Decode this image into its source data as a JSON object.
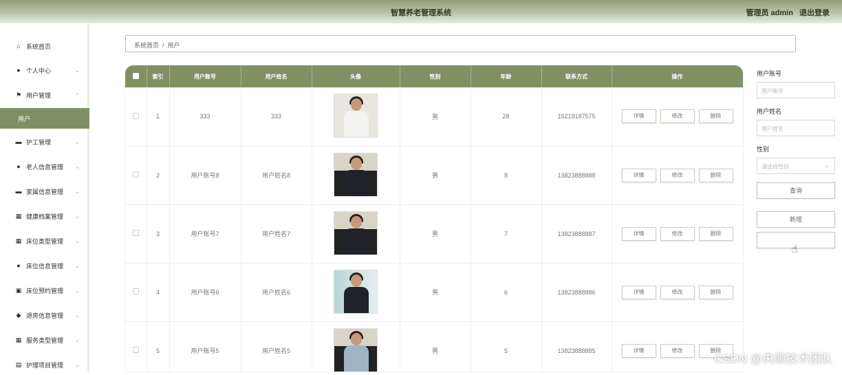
{
  "header": {
    "title": "智慧养老管理系统",
    "user_role": "管理员 admin",
    "logout": "退出登录"
  },
  "sidebar": {
    "items": [
      {
        "label": "系统首页",
        "icon": "home-icon",
        "glyph": "⌂",
        "chevron": ""
      },
      {
        "label": "个人中心",
        "icon": "person-icon",
        "glyph": "●",
        "chevron": "⌄"
      },
      {
        "label": "用户管理",
        "icon": "flag-icon",
        "glyph": "⚑",
        "chevron": "⌃"
      },
      {
        "label": "用户",
        "icon": "",
        "glyph": "",
        "chevron": ""
      },
      {
        "label": "护工管理",
        "icon": "printer-icon",
        "glyph": "▬",
        "chevron": "⌄"
      },
      {
        "label": "老人信息管理",
        "icon": "person-icon",
        "glyph": "●",
        "chevron": "⌄"
      },
      {
        "label": "家属信息管理",
        "icon": "briefcase-icon",
        "glyph": "▬",
        "chevron": "⌄"
      },
      {
        "label": "健康档案管理",
        "icon": "grid-icon",
        "glyph": "▦",
        "chevron": "⌄"
      },
      {
        "label": "床位类型管理",
        "icon": "grid-icon",
        "glyph": "▦",
        "chevron": "⌄"
      },
      {
        "label": "床位信息管理",
        "icon": "person-icon",
        "glyph": "●",
        "chevron": "⌄"
      },
      {
        "label": "床位预约管理",
        "icon": "edit-icon",
        "glyph": "▣",
        "chevron": "⌄"
      },
      {
        "label": "退房信息管理",
        "icon": "location-icon",
        "glyph": "◆",
        "chevron": "⌄"
      },
      {
        "label": "服务类型管理",
        "icon": "grid-icon",
        "glyph": "▦",
        "chevron": "⌄"
      },
      {
        "label": "护理项目管理",
        "icon": "document-icon",
        "glyph": "▤",
        "chevron": "⌄"
      }
    ],
    "active_index": 3
  },
  "breadcrumb": {
    "home": "系统首页",
    "separator": "/",
    "current": "用户"
  },
  "table": {
    "columns": [
      "",
      "索引",
      "用户账号",
      "用户姓名",
      "头像",
      "性别",
      "年龄",
      "联系方式",
      "操作"
    ],
    "rows": [
      {
        "index": "1",
        "account": "333",
        "name": "333",
        "gender": "男",
        "age": "28",
        "phone": "15219187575",
        "avatar": "white"
      },
      {
        "index": "2",
        "account": "用户账号8",
        "name": "用户姓名8",
        "gender": "男",
        "age": "8",
        "phone": "13823888888",
        "avatar": "dark"
      },
      {
        "index": "3",
        "account": "用户账号7",
        "name": "用户姓名7",
        "gender": "男",
        "age": "7",
        "phone": "13823888887",
        "avatar": "dark"
      },
      {
        "index": "4",
        "account": "用户账号6",
        "name": "用户姓名6",
        "gender": "男",
        "age": "6",
        "phone": "13823888886",
        "avatar": "glass"
      },
      {
        "index": "5",
        "account": "用户账号5",
        "name": "用户姓名5",
        "gender": "男",
        "age": "5",
        "phone": "13823888885",
        "avatar": "blue"
      }
    ],
    "actions": {
      "detail": "详情",
      "edit": "修改",
      "delete": "删除"
    }
  },
  "filter": {
    "account_label": "用户账号",
    "account_placeholder": "用户账号",
    "name_label": "用户姓名",
    "name_placeholder": "用户姓名",
    "gender_label": "性别",
    "gender_placeholder": "请选择性别",
    "search_button": "查询",
    "add_button": "新增",
    "empty_button": ""
  },
  "watermark": "CSDN @央顺技术团队",
  "colors": {
    "accent": "#7f9164",
    "header_start": "#8f9f79"
  }
}
